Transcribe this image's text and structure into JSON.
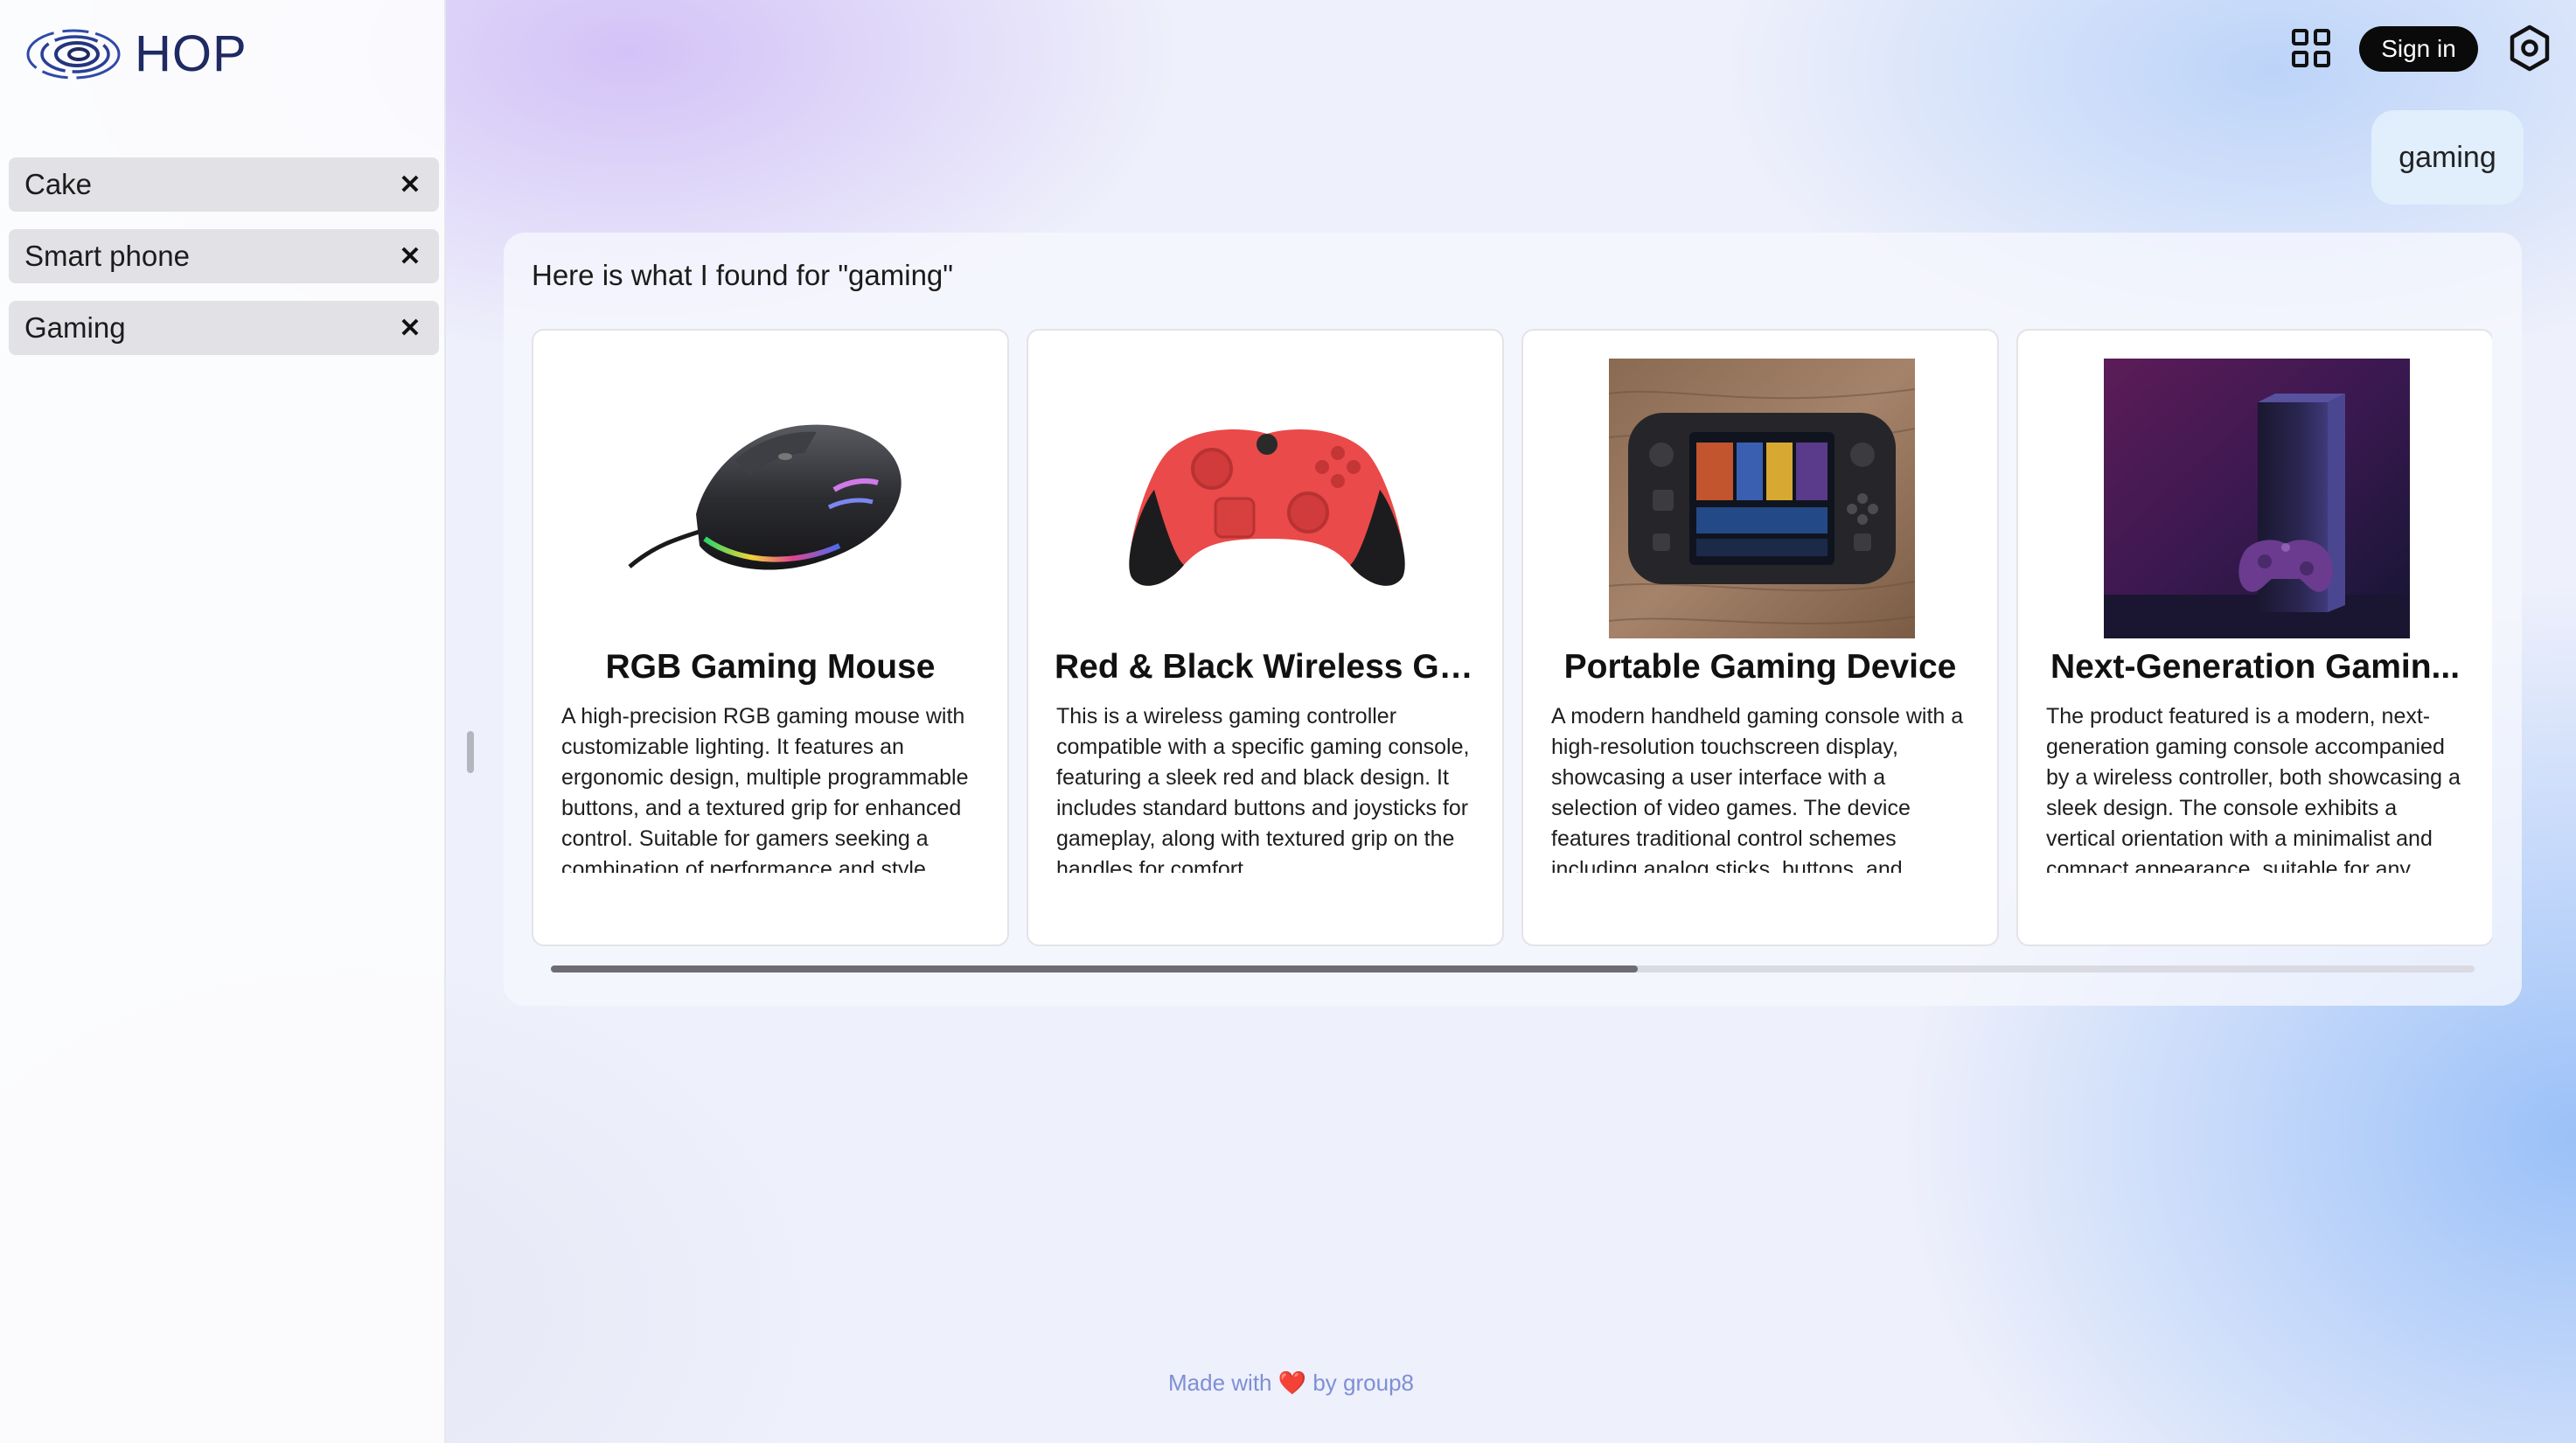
{
  "sidebar": {
    "logo_text": "HOP",
    "history": [
      {
        "label": "Cake",
        "close_symbol": "✕"
      },
      {
        "label": "Smart phone",
        "close_symbol": "✕"
      },
      {
        "label": "Gaming",
        "close_symbol": "✕"
      }
    ]
  },
  "header": {
    "apps_icon": "grid-icon",
    "signin_label": "Sign in",
    "settings_icon": "settings-icon"
  },
  "chat": {
    "query": "gaming",
    "results_heading": "Here is what I found for \"gaming\"",
    "results": [
      {
        "title": "RGB Gaming Mouse",
        "description": "A high-precision RGB gaming mouse with customizable lighting. It features an ergonomic design, multiple programmable buttons, and a textured grip for enhanced control. Suitable for gamers seeking a combination of performance and style.",
        "image": "gaming-mouse"
      },
      {
        "title": "Red & Black Wireless Ga...",
        "description": "This is a wireless gaming controller compatible with a specific gaming console, featuring a sleek red and black design. It includes standard buttons and joysticks for gameplay, along with textured grip on the handles for comfort.",
        "image": "game-controller"
      },
      {
        "title": "Portable Gaming Device",
        "description": "A modern handheld gaming console with a high-resolution touchscreen display, showcasing a user interface with a selection of video games. The device features traditional control schemes including analog sticks, buttons, and triggers.",
        "image": "handheld-console"
      },
      {
        "title": "Next-Generation Gamin...",
        "description": "The product featured is a modern, next-generation gaming console accompanied by a wireless controller, both showcasing a sleek design. The console exhibits a vertical orientation with a minimalist and compact appearance, suitable for any setup.",
        "image": "console-tower"
      }
    ],
    "scroll_fraction": 0.565
  },
  "footer": {
    "made_with": "Made with",
    "heart": "❤️",
    "by": "by group8"
  },
  "colors": {
    "accent_dark": "#1f2a63",
    "signin_bg": "#0a0a0a",
    "footer_text": "#7d8fd6",
    "controller_red": "#e84848"
  }
}
